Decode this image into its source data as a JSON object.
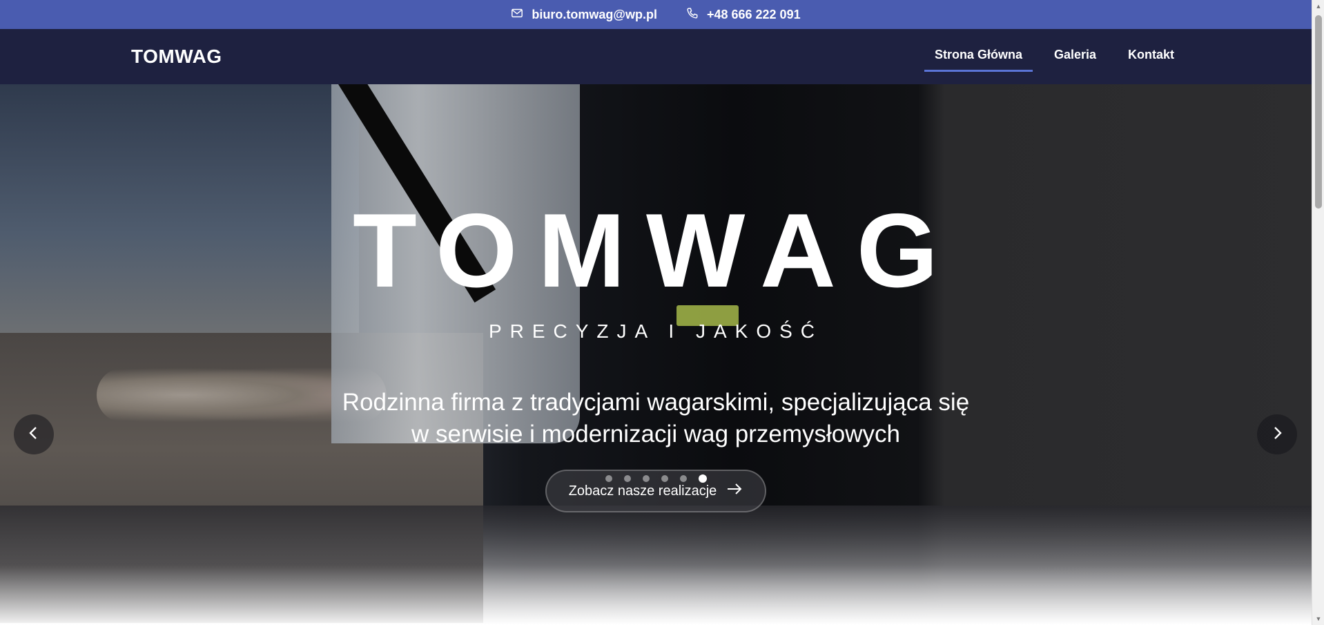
{
  "topbar": {
    "email": "biuro.tomwag@wp.pl",
    "phone": "+48 666 222 091",
    "email_icon": "mail-icon",
    "phone_icon": "phone-icon"
  },
  "nav": {
    "logo": "TOMWAG",
    "links": [
      "Strona Główna",
      "Galeria",
      "Kontakt"
    ],
    "active_index": 0
  },
  "hero": {
    "title": "TOMWAG",
    "subtitle": "PRECYZJA I JAKOŚĆ",
    "description_line1": "Rodzinna firma z tradycjami wagarskimi, specjalizująca się",
    "description_line2": "w serwisie i modernizacji wag przemysłowych",
    "cta_label": "Zobacz nasze realizacje",
    "slide_count": 6,
    "active_slide": 6
  },
  "colors": {
    "topbar": "#4a5cb0",
    "navbar": "#1e2140",
    "accent": "#5a74d6"
  }
}
